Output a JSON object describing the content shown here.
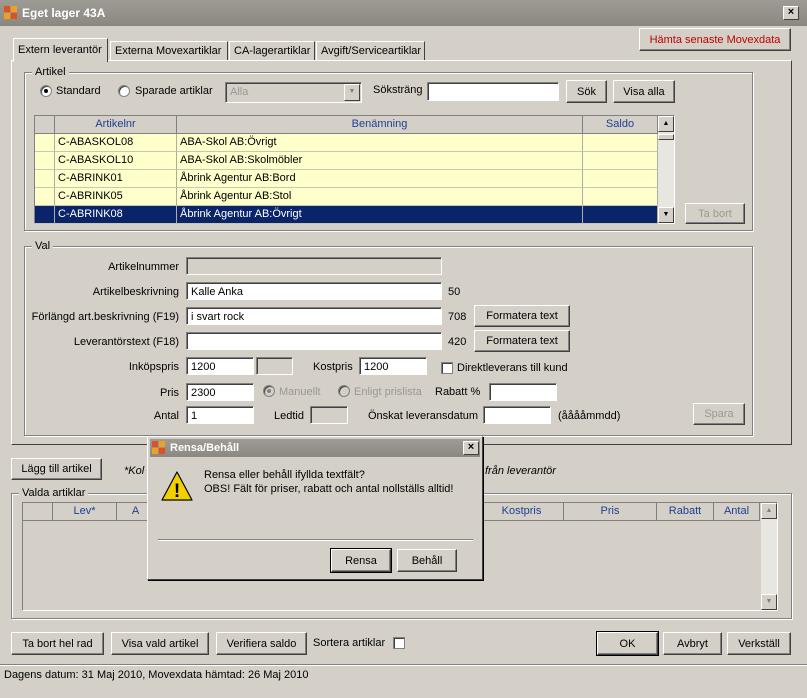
{
  "window": {
    "title": "Eget lager 43A"
  },
  "tabs": [
    "Extern leverantör",
    "Externa Movexartiklar",
    "CA-lagerartiklar",
    "Avgift/Serviceartiklar"
  ],
  "fetch_button": "Hämta senaste Movexdata",
  "artikel": {
    "group_label": "Artikel",
    "radio_standard": "Standard",
    "radio_saved": "Sparade artiklar",
    "saved_select": "Alla",
    "search_label": "Söksträng",
    "search_value": "",
    "search_button": "Sök",
    "show_all_button": "Visa alla",
    "remove_button": "Ta bort",
    "columns": [
      "Artikelnr",
      "Benämning",
      "Saldo"
    ],
    "rows": [
      {
        "nr": "C-ABASKOL08",
        "name": "ABA-Skol AB:Övrigt",
        "saldo": ""
      },
      {
        "nr": "C-ABASKOL10",
        "name": "ABA-Skol AB:Skolmöbler",
        "saldo": ""
      },
      {
        "nr": "C-ABRINK01",
        "name": "Åbrink Agentur AB:Bord",
        "saldo": ""
      },
      {
        "nr": "C-ABRINK05",
        "name": "Åbrink Agentur AB:Stol",
        "saldo": ""
      },
      {
        "nr": "C-ABRINK08",
        "name": "Åbrink Agentur AB:Övrigt",
        "saldo": ""
      }
    ]
  },
  "val": {
    "group_label": "Val",
    "artikelnummer_label": "Artikelnummer",
    "artikelnummer_value": "",
    "beskrivning_label": "Artikelbeskrivning",
    "beskrivning_value": "Kalle Anka",
    "beskrivning_limit": "50",
    "forlangd_label": "Förlängd art.beskrivning (F19)",
    "forlangd_value": "i svart rock",
    "forlangd_limit": "708",
    "lev_text_label": "Leverantörstext (F18)",
    "lev_text_value": "",
    "lev_text_limit": "420",
    "format_button": "Formatera text",
    "inkopspris_label": "Inköpspris",
    "inkopspris_value": "1200",
    "inkopspris_extra": "",
    "kostpris_label": "Kostpris",
    "kostpris_value": "1200",
    "direkt_label": "Direktleverans till kund",
    "pris_label": "Pris",
    "pris_value": "2300",
    "manuellt_label": "Manuellt",
    "enligt_label": "Enligt prislista",
    "rabatt_label": "Rabatt %",
    "rabatt_value": "",
    "antal_label": "Antal",
    "antal_value": "1",
    "ledtid_label": "Ledtid",
    "ledtid_value": "",
    "datum_label": "Önskat leveransdatum",
    "datum_value": "",
    "datum_hint": "(ååååmmdd)",
    "save_button": "Spara"
  },
  "add_button": "Lägg till artikel",
  "note_left": "*Kol",
  "note_right": "från leverantör",
  "valda": {
    "group_label": "Valda artiklar",
    "columns": [
      "Lev*",
      "A",
      "Kostpris",
      "Pris",
      "Rabatt",
      "Antal"
    ]
  },
  "bottom": {
    "remove_row": "Ta bort hel rad",
    "show_selected": "Visa vald artikel",
    "verify_balance": "Verifiera saldo",
    "sort_label": "Sortera artiklar",
    "ok": "OK",
    "cancel": "Avbryt",
    "apply": "Verkställ"
  },
  "status": "Dagens datum: 31 Maj 2010, Movexdata hämtad: 26 Maj 2010",
  "dialog": {
    "title": "Rensa/Behåll",
    "line1": "Rensa eller behåll ifyllda textfält?",
    "line2": "OBS! Fält för priser, rabatt och antal nollställs alltid!",
    "clear_button": "Rensa",
    "keep_button": "Behåll",
    "warning_glyph": "!"
  },
  "colors": {
    "selection": "#0a246a",
    "row_highlight": "#ffffcc",
    "fetch_text": "#c00000",
    "header_text": "#1c3f94"
  }
}
